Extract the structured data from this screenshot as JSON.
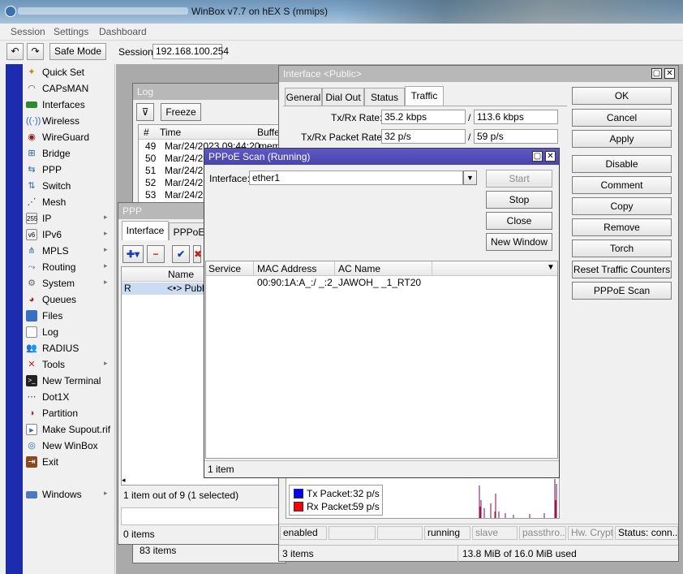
{
  "app": {
    "title": "WinBox v7.7 on hEX S (mmips)"
  },
  "menu": [
    "Session",
    "Settings",
    "Dashboard"
  ],
  "toolbar": {
    "safe_mode": "Safe Mode",
    "session_label": "Session:",
    "session_value": "192.168.100.254"
  },
  "sidebar": {
    "items": [
      {
        "label": "Quick Set",
        "icon": "wand-icon"
      },
      {
        "label": "CAPsMAN",
        "icon": "antenna-icon"
      },
      {
        "label": "Interfaces",
        "icon": "interfaces-icon"
      },
      {
        "label": "Wireless",
        "icon": "wireless-icon"
      },
      {
        "label": "WireGuard",
        "icon": "wireguard-icon"
      },
      {
        "label": "Bridge",
        "icon": "bridge-icon"
      },
      {
        "label": "PPP",
        "icon": "ppp-icon"
      },
      {
        "label": "Switch",
        "icon": "switch-icon"
      },
      {
        "label": "Mesh",
        "icon": "mesh-icon"
      },
      {
        "label": "IP",
        "icon": "ip-icon",
        "arrow": "▸"
      },
      {
        "label": "IPv6",
        "icon": "ipv6-icon",
        "arrow": "▸"
      },
      {
        "label": "MPLS",
        "icon": "mpls-icon",
        "arrow": "▸"
      },
      {
        "label": "Routing",
        "icon": "routing-icon",
        "arrow": "▸"
      },
      {
        "label": "System",
        "icon": "gear-icon",
        "arrow": "▸"
      },
      {
        "label": "Queues",
        "icon": "queues-icon"
      },
      {
        "label": "Files",
        "icon": "folder-icon"
      },
      {
        "label": "Log",
        "icon": "log-icon"
      },
      {
        "label": "RADIUS",
        "icon": "radius-icon"
      },
      {
        "label": "Tools",
        "icon": "tools-icon",
        "arrow": "▸"
      },
      {
        "label": "New Terminal",
        "icon": "terminal-icon"
      },
      {
        "label": "Dot1X",
        "icon": "dot1x-icon"
      },
      {
        "label": "Partition",
        "icon": "partition-icon"
      },
      {
        "label": "Make Supout.rif",
        "icon": "supout-icon"
      },
      {
        "label": "New WinBox",
        "icon": "winbox-icon"
      },
      {
        "label": "Exit",
        "icon": "exit-icon"
      },
      {
        "label": "Windows",
        "icon": "windows-icon",
        "arrow": "▸"
      }
    ]
  },
  "log": {
    "title": "Log",
    "freeze": "Freeze",
    "columns": [
      "#",
      "Time",
      "Buffe"
    ],
    "rows": [
      {
        "num": "49",
        "time": "Mar/24/2023 09:44:20",
        "buffer": "mem"
      },
      {
        "num": "50",
        "time": "Mar/24/20",
        "buffer": ""
      },
      {
        "num": "51",
        "time": "Mar/24/20",
        "buffer": ""
      },
      {
        "num": "52",
        "time": "Mar/24/20",
        "buffer": ""
      },
      {
        "num": "53",
        "time": "Mar/24/20",
        "buffer": ""
      }
    ],
    "status": "83 items"
  },
  "ppp": {
    "title": "PPP",
    "tabs": [
      "Interface",
      "PPPoE"
    ],
    "columns": [
      "Name"
    ],
    "row": {
      "flag": "R",
      "name": "<•> Public"
    },
    "status": "1 item out of 9 (1 selected)",
    "status2": "0 items"
  },
  "interface": {
    "title": "Interface <Public>",
    "tabs": [
      "General",
      "Dial Out",
      "Status",
      "Traffic"
    ],
    "tx_rx_rate_label": "Tx/Rx Rate:",
    "tx_rate": "35.2 kbps",
    "rx_rate": "113.6 kbps",
    "packet_rate_label": "Tx/Rx Packet Rate:",
    "tx_packet_rate": "32 p/s",
    "rx_packet_rate": "59 p/s",
    "slash": "/",
    "legend": [
      {
        "label": "Tx Packet:",
        "value": "32 p/s",
        "color": "#0000ff"
      },
      {
        "label": "Rx Packet:",
        "value": "59 p/s",
        "color": "#ff0000"
      }
    ],
    "buttons": [
      "OK",
      "Cancel",
      "Apply",
      "Disable",
      "Comment",
      "Copy",
      "Remove",
      "Torch",
      "Reset Traffic Counters",
      "PPPoE Scan"
    ],
    "status_cells": [
      "enabled",
      "",
      "",
      "running",
      "slave",
      "passthro...",
      "Hw. Crypto",
      "Status: conn..."
    ],
    "footer_left": "3 items",
    "footer_right": "13.8 MiB of 16.0 MiB used"
  },
  "scan": {
    "title": "PPPoE Scan (Running)",
    "interface_label": "Interface:",
    "interface_value": "ether1",
    "buttons": {
      "start": "Start",
      "stop": "Stop",
      "close": "Close",
      "new_window": "New Window"
    },
    "columns": [
      "Service",
      "MAC Address",
      "AC Name"
    ],
    "rows": [
      {
        "service": "",
        "mac": "00:90:1A:A_:/ _:2_",
        "ac_name": "JAWOH_ _1_RT20"
      }
    ],
    "status": "1 item"
  }
}
